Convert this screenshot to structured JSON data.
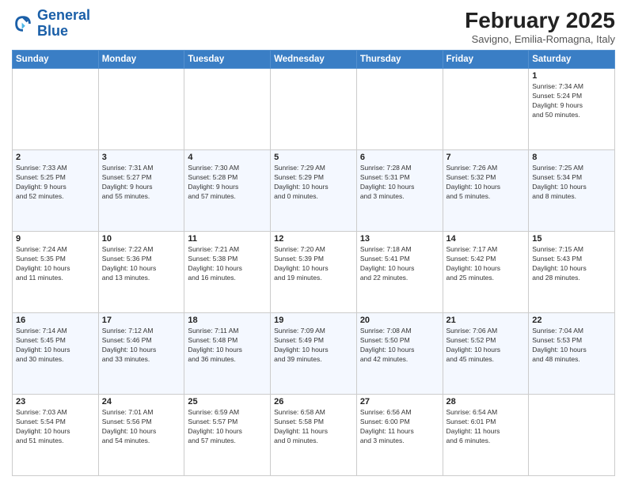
{
  "header": {
    "logo_line1": "General",
    "logo_line2": "Blue",
    "month_title": "February 2025",
    "location": "Savigno, Emilia-Romagna, Italy"
  },
  "weekdays": [
    "Sunday",
    "Monday",
    "Tuesday",
    "Wednesday",
    "Thursday",
    "Friday",
    "Saturday"
  ],
  "weeks": [
    [
      {
        "day": "",
        "info": ""
      },
      {
        "day": "",
        "info": ""
      },
      {
        "day": "",
        "info": ""
      },
      {
        "day": "",
        "info": ""
      },
      {
        "day": "",
        "info": ""
      },
      {
        "day": "",
        "info": ""
      },
      {
        "day": "1",
        "info": "Sunrise: 7:34 AM\nSunset: 5:24 PM\nDaylight: 9 hours\nand 50 minutes."
      }
    ],
    [
      {
        "day": "2",
        "info": "Sunrise: 7:33 AM\nSunset: 5:25 PM\nDaylight: 9 hours\nand 52 minutes."
      },
      {
        "day": "3",
        "info": "Sunrise: 7:31 AM\nSunset: 5:27 PM\nDaylight: 9 hours\nand 55 minutes."
      },
      {
        "day": "4",
        "info": "Sunrise: 7:30 AM\nSunset: 5:28 PM\nDaylight: 9 hours\nand 57 minutes."
      },
      {
        "day": "5",
        "info": "Sunrise: 7:29 AM\nSunset: 5:29 PM\nDaylight: 10 hours\nand 0 minutes."
      },
      {
        "day": "6",
        "info": "Sunrise: 7:28 AM\nSunset: 5:31 PM\nDaylight: 10 hours\nand 3 minutes."
      },
      {
        "day": "7",
        "info": "Sunrise: 7:26 AM\nSunset: 5:32 PM\nDaylight: 10 hours\nand 5 minutes."
      },
      {
        "day": "8",
        "info": "Sunrise: 7:25 AM\nSunset: 5:34 PM\nDaylight: 10 hours\nand 8 minutes."
      }
    ],
    [
      {
        "day": "9",
        "info": "Sunrise: 7:24 AM\nSunset: 5:35 PM\nDaylight: 10 hours\nand 11 minutes."
      },
      {
        "day": "10",
        "info": "Sunrise: 7:22 AM\nSunset: 5:36 PM\nDaylight: 10 hours\nand 13 minutes."
      },
      {
        "day": "11",
        "info": "Sunrise: 7:21 AM\nSunset: 5:38 PM\nDaylight: 10 hours\nand 16 minutes."
      },
      {
        "day": "12",
        "info": "Sunrise: 7:20 AM\nSunset: 5:39 PM\nDaylight: 10 hours\nand 19 minutes."
      },
      {
        "day": "13",
        "info": "Sunrise: 7:18 AM\nSunset: 5:41 PM\nDaylight: 10 hours\nand 22 minutes."
      },
      {
        "day": "14",
        "info": "Sunrise: 7:17 AM\nSunset: 5:42 PM\nDaylight: 10 hours\nand 25 minutes."
      },
      {
        "day": "15",
        "info": "Sunrise: 7:15 AM\nSunset: 5:43 PM\nDaylight: 10 hours\nand 28 minutes."
      }
    ],
    [
      {
        "day": "16",
        "info": "Sunrise: 7:14 AM\nSunset: 5:45 PM\nDaylight: 10 hours\nand 30 minutes."
      },
      {
        "day": "17",
        "info": "Sunrise: 7:12 AM\nSunset: 5:46 PM\nDaylight: 10 hours\nand 33 minutes."
      },
      {
        "day": "18",
        "info": "Sunrise: 7:11 AM\nSunset: 5:48 PM\nDaylight: 10 hours\nand 36 minutes."
      },
      {
        "day": "19",
        "info": "Sunrise: 7:09 AM\nSunset: 5:49 PM\nDaylight: 10 hours\nand 39 minutes."
      },
      {
        "day": "20",
        "info": "Sunrise: 7:08 AM\nSunset: 5:50 PM\nDaylight: 10 hours\nand 42 minutes."
      },
      {
        "day": "21",
        "info": "Sunrise: 7:06 AM\nSunset: 5:52 PM\nDaylight: 10 hours\nand 45 minutes."
      },
      {
        "day": "22",
        "info": "Sunrise: 7:04 AM\nSunset: 5:53 PM\nDaylight: 10 hours\nand 48 minutes."
      }
    ],
    [
      {
        "day": "23",
        "info": "Sunrise: 7:03 AM\nSunset: 5:54 PM\nDaylight: 10 hours\nand 51 minutes."
      },
      {
        "day": "24",
        "info": "Sunrise: 7:01 AM\nSunset: 5:56 PM\nDaylight: 10 hours\nand 54 minutes."
      },
      {
        "day": "25",
        "info": "Sunrise: 6:59 AM\nSunset: 5:57 PM\nDaylight: 10 hours\nand 57 minutes."
      },
      {
        "day": "26",
        "info": "Sunrise: 6:58 AM\nSunset: 5:58 PM\nDaylight: 11 hours\nand 0 minutes."
      },
      {
        "day": "27",
        "info": "Sunrise: 6:56 AM\nSunset: 6:00 PM\nDaylight: 11 hours\nand 3 minutes."
      },
      {
        "day": "28",
        "info": "Sunrise: 6:54 AM\nSunset: 6:01 PM\nDaylight: 11 hours\nand 6 minutes."
      },
      {
        "day": "",
        "info": ""
      }
    ]
  ]
}
